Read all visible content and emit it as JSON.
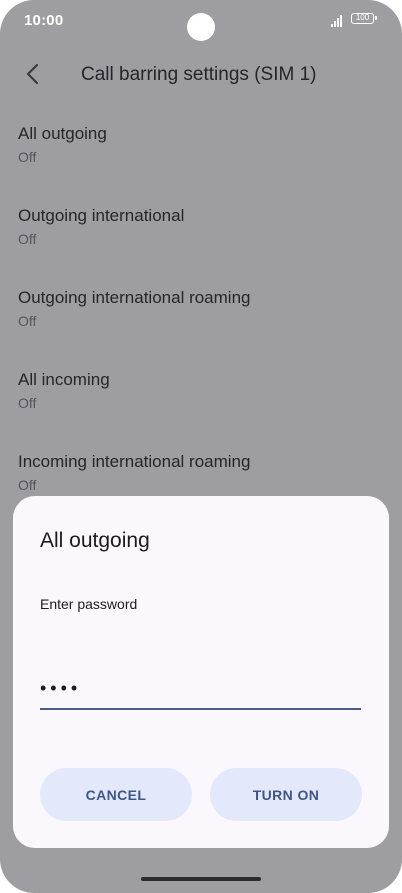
{
  "status_bar": {
    "time": "10:00",
    "battery": "100",
    "icons": [
      "signal-icon",
      "battery-icon"
    ]
  },
  "app_bar": {
    "title": "Call barring settings (SIM 1)",
    "back_icon": "back-arrow-icon"
  },
  "settings": [
    {
      "title": "All outgoing",
      "status": "Off"
    },
    {
      "title": "Outgoing international",
      "status": "Off"
    },
    {
      "title": "Outgoing international roaming",
      "status": "Off"
    },
    {
      "title": "All incoming",
      "status": "Off"
    },
    {
      "title": "Incoming international roaming",
      "status": "Off"
    }
  ],
  "dialog": {
    "title": "All outgoing",
    "label": "Enter password",
    "password_value": "••••",
    "cancel_label": "CANCEL",
    "confirm_label": "TURN ON"
  },
  "colors": {
    "scrim": "#9e9da2",
    "dialog_bg": "#fbf8fd",
    "button_bg": "#e3e8fb",
    "button_text": "#3f5688",
    "input_underline": "#4b5e86"
  }
}
